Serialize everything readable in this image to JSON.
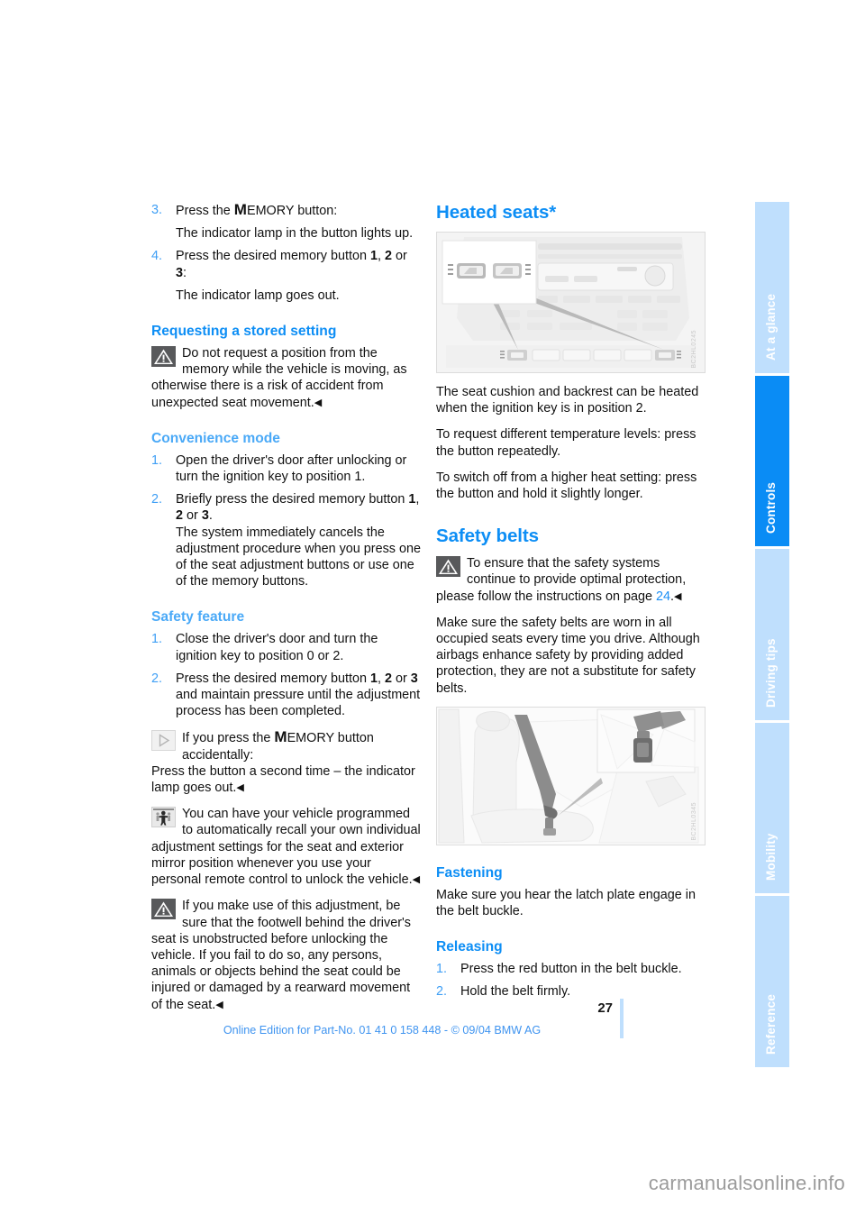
{
  "document": {
    "page_number": "27",
    "edition_line": "Online Edition for Part-No. 01 41 0 158 448 - © 09/04 BMW AG",
    "watermark": "carmanualsonline.info"
  },
  "tabs": [
    {
      "label": "At a glance",
      "active": false
    },
    {
      "label": "Controls",
      "active": true
    },
    {
      "label": "Driving tips",
      "active": false
    },
    {
      "label": "Mobility",
      "active": false
    },
    {
      "label": "Reference",
      "active": false
    }
  ],
  "left_column": {
    "memory_steps": [
      {
        "num": "3.",
        "text_before": "Press the ",
        "emphasis": "M",
        "text_small": "EMORY",
        "text_after": " button:",
        "sub": "The indicator lamp in the button lights up."
      },
      {
        "num": "4.",
        "text_before": "Press the desired memory button ",
        "b1": "1",
        "sep1": ", ",
        "b2": "2",
        "sep2": " or ",
        "b3": "3",
        "text_after": ":",
        "sub": "The indicator lamp goes out."
      }
    ],
    "requesting": {
      "heading": "Requesting a stored setting",
      "warning_icon": "warning-triangle-icon",
      "warning_text": "Do not request a position from the memory while the vehicle is moving, as otherwise there is a risk of accident from unexpected seat movement.",
      "end_mark": "◀"
    },
    "convenience": {
      "heading": "Convenience mode",
      "steps": [
        {
          "num": "1.",
          "text": "Open the driver's door after unlocking or turn the ignition key to position 1."
        },
        {
          "num": "2.",
          "text_before": "Briefly press the desired memory button ",
          "b1": "1",
          "sep1": ", ",
          "b2": "2",
          "sep2": " or ",
          "b3": "3",
          "text_after": ".",
          "sub": "The system immediately cancels the adjustment procedure when you press one of the seat adjustment buttons or use one of the memory buttons."
        }
      ]
    },
    "safety_feature": {
      "heading": "Safety feature",
      "steps": [
        {
          "num": "1.",
          "text": "Close the driver's door and turn the ignition key to position 0 or 2."
        },
        {
          "num": "2.",
          "text_before": "Press the desired memory button ",
          "b1": "1",
          "sep1": ", ",
          "b2": "2",
          "sep2": " or ",
          "b3": "3",
          "text_after": " and maintain pressure until the adjustment process has been completed."
        }
      ],
      "tip": {
        "icon": "tip-triangle-icon",
        "text_before": "If you press the ",
        "emphasis": "M",
        "text_small": "EMORY",
        "text_after": " button accidentally:",
        "followup": "Press the button a second time – the indicator lamp goes out.",
        "end_mark": "◀"
      },
      "programming": {
        "icon": "personal-programming-icon",
        "text": "You can have your vehicle programmed to automatically recall your own individual adjustment settings for the seat and exterior mirror position whenever you use your personal remote control to unlock the vehicle.",
        "end_mark": "◀"
      },
      "warning": {
        "icon": "warning-triangle-icon",
        "text": "If you make use of this adjustment, be sure that the footwell behind the driver's seat is unobstructed before unlocking the vehicle. If you fail to do so, any persons, animals or objects behind the seat could be injured or damaged by a rearward movement of the seat.",
        "end_mark": "◀"
      }
    }
  },
  "right_column": {
    "heated_seats": {
      "heading": "Heated seats*",
      "figure_name": "center-console-heated-seat-buttons-figure",
      "figure_code": "BC2HL0245",
      "paragraphs": [
        "The seat cushion and backrest can be heated when the ignition key is in position 2.",
        "To request different temperature levels: press the button repeatedly.",
        "To switch off from a higher heat setting: press the button and hold it slightly longer."
      ]
    },
    "safety_belts": {
      "heading": "Safety belts",
      "warning": {
        "icon": "warning-triangle-icon",
        "text_before": "To ensure that the safety systems continue to provide optimal protection, please follow the instructions on page ",
        "page_ref": "24",
        "text_after": ".",
        "end_mark": "◀"
      },
      "paragraph": "Make sure the safety belts are worn in all occupied seats every time you drive. Although airbags enhance safety by providing added protection, they are not a substitute for safety belts.",
      "figure_name": "safety-belt-latch-plate-figure",
      "figure_code": "BC2HL0345",
      "fastening": {
        "heading": "Fastening",
        "text": "Make sure you hear the latch plate engage in the belt buckle."
      },
      "releasing": {
        "heading": "Releasing",
        "steps": [
          {
            "num": "1.",
            "text": "Press the red button in the belt buckle."
          },
          {
            "num": "2.",
            "text": "Hold the belt firmly."
          }
        ]
      }
    }
  }
}
